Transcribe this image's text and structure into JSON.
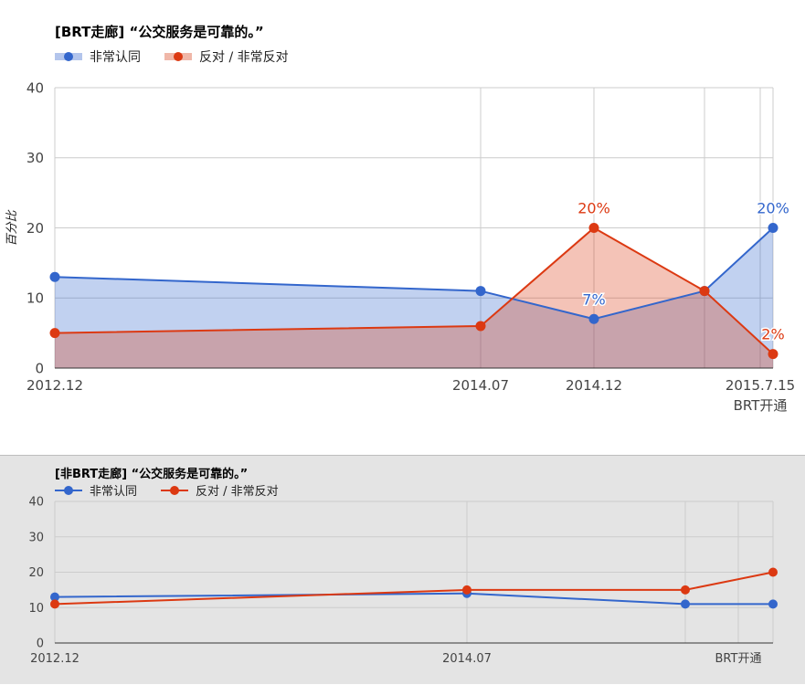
{
  "colors": {
    "agree": "#3366cc",
    "oppose": "#dc3912",
    "agree_fill": "#b3c5ec",
    "oppose_fill": "#f0b7a8"
  },
  "chart_data": [
    {
      "type": "area",
      "title": "[BRT走廊] “公交服务是可靠的。”",
      "ylabel": "百分比",
      "xlabel": "",
      "ylim": [
        0,
        40
      ],
      "yticks": [
        "0",
        "10",
        "20",
        "30",
        "40"
      ],
      "xtick_labels": [
        "2012.12",
        "2014.07",
        "2014.12",
        "2015.7.15",
        "BRT开通"
      ],
      "legend_position": "top-left",
      "grid": true,
      "series": [
        {
          "name": "非常认同",
          "color": "#3366cc",
          "values": [
            13,
            11,
            7,
            11,
            20
          ],
          "labels": [
            "",
            "",
            "7%",
            "",
            "20%"
          ]
        },
        {
          "name": "反对 / 非常反对",
          "color": "#dc3912",
          "values": [
            5,
            6,
            20,
            11,
            2
          ],
          "labels": [
            "",
            "",
            "20%",
            "",
            "2%"
          ]
        }
      ]
    },
    {
      "type": "line",
      "title": "[非BRT走廊] “公交服务是可靠的。”",
      "ylabel": "",
      "xlabel": "",
      "ylim": [
        0,
        40
      ],
      "yticks": [
        "0",
        "10",
        "20",
        "30",
        "40"
      ],
      "xtick_labels": [
        "2012.12",
        "2014.07",
        "BRT开通"
      ],
      "legend_position": "top-left",
      "grid": true,
      "series": [
        {
          "name": "非常认同",
          "color": "#3366cc",
          "values": [
            13,
            14,
            11,
            11
          ]
        },
        {
          "name": "反对 / 非常反对",
          "color": "#dc3912",
          "values": [
            11,
            15,
            15,
            20
          ]
        }
      ]
    }
  ]
}
